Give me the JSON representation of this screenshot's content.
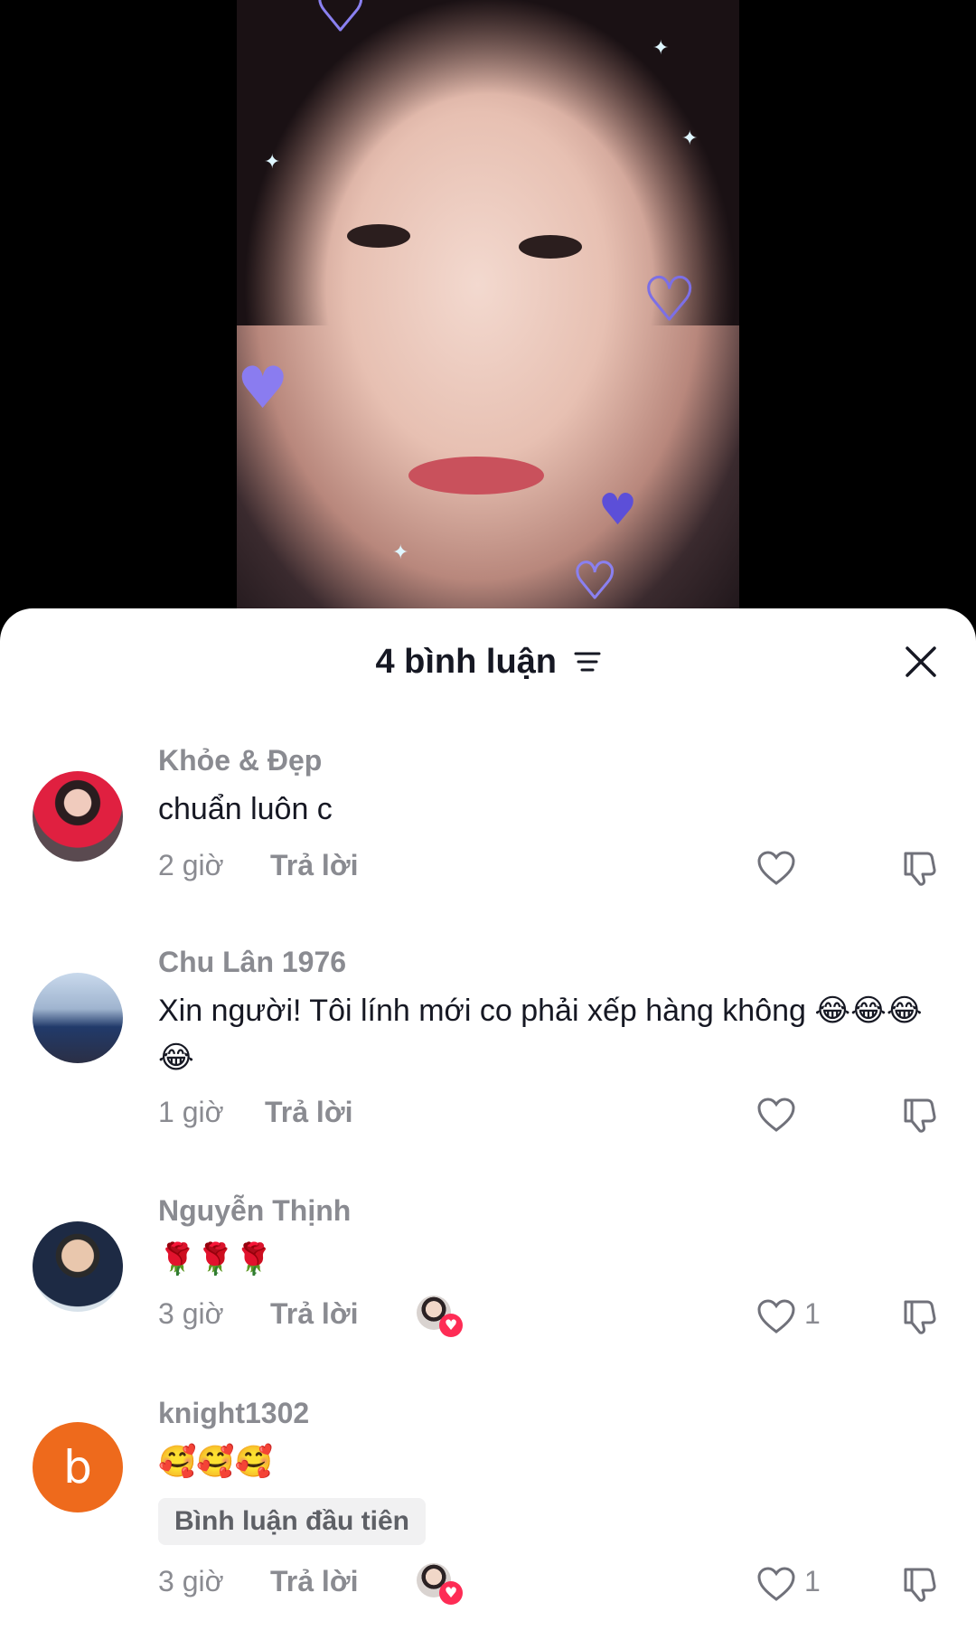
{
  "sheet": {
    "title": "4 bình luận",
    "sort_icon": "sort-lines-icon",
    "close_icon": "close-x-icon"
  },
  "comments": [
    {
      "username": "Khỏe & Đẹp",
      "text": "chuẩn luôn c",
      "time": "2 giờ",
      "reply_label": "Trả lời",
      "like_count": "",
      "liked_by_creator": false
    },
    {
      "username": "Chu Lân 1976",
      "text": "Xin người! Tôi lính mới co phải xếp hàng không 😂😂😂😂",
      "time": "1 giờ",
      "reply_label": "Trả lời",
      "like_count": "",
      "liked_by_creator": false
    },
    {
      "username": "Nguyễn Thịnh",
      "text": "🌹🌹🌹",
      "time": "3 giờ",
      "reply_label": "Trả lời",
      "like_count": "1",
      "liked_by_creator": true
    },
    {
      "username": "knight1302",
      "avatar_letter": "b",
      "text": "🥰🥰🥰",
      "badge": "Bình luận đầu tiên",
      "time": "3 giờ",
      "reply_label": "Trả lời",
      "like_count": "1",
      "liked_by_creator": true
    }
  ],
  "colors": {
    "text_primary": "#161823",
    "text_secondary": "#8a8b91",
    "like_badge": "#fe2c55",
    "avatar_orange": "#ee6a1c"
  }
}
